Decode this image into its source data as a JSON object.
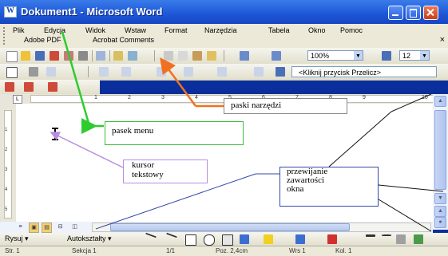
{
  "window": {
    "title": "Dokument1 - Microsoft Word"
  },
  "menu": {
    "items": [
      "Plik",
      "Edycja",
      "Widok",
      "Wstaw",
      "Format",
      "Narzędzia",
      "Tabela",
      "Okno",
      "Pomoc"
    ],
    "row2": [
      "Adobe PDF",
      "Acrobat Comments"
    ],
    "close_glyph": "×"
  },
  "toolbar": {
    "zoom": "100%",
    "font_size": "12",
    "help_placeholder": "<Kliknij przycisk Przelicz>"
  },
  "ruler": {
    "numbers": [
      "1",
      "2",
      "3",
      "4",
      "5",
      "6",
      "7",
      "8",
      "9",
      "10"
    ]
  },
  "vruler": {
    "numbers": [
      "1",
      "2",
      "3",
      "4",
      "5"
    ]
  },
  "drawing": {
    "rysuj": "Rysuj ▾",
    "autoksztalty": "Autokształty ▾"
  },
  "status": {
    "strona": "Str. 1",
    "sekcja": "Sekcja 1",
    "pages": "1/1",
    "poz": "Poz. 2,4cm",
    "wrs": "Wrs 1",
    "kol": "Kol. 1"
  },
  "callouts": {
    "menu": "pasek menu",
    "toolbars": "paski narzędzi",
    "cursor_1": "kursor",
    "cursor_2": "tekstowy",
    "scroll_1": "przewijanie",
    "scroll_2": "zawartości",
    "scroll_3": "okna"
  },
  "colors": {
    "title_blue": "#1d56d6",
    "arrow_green": "#2ecc2e",
    "arrow_orange": "#f07020",
    "arrow_purple": "#b68ee0",
    "arrow_navy": "#3448a8"
  }
}
